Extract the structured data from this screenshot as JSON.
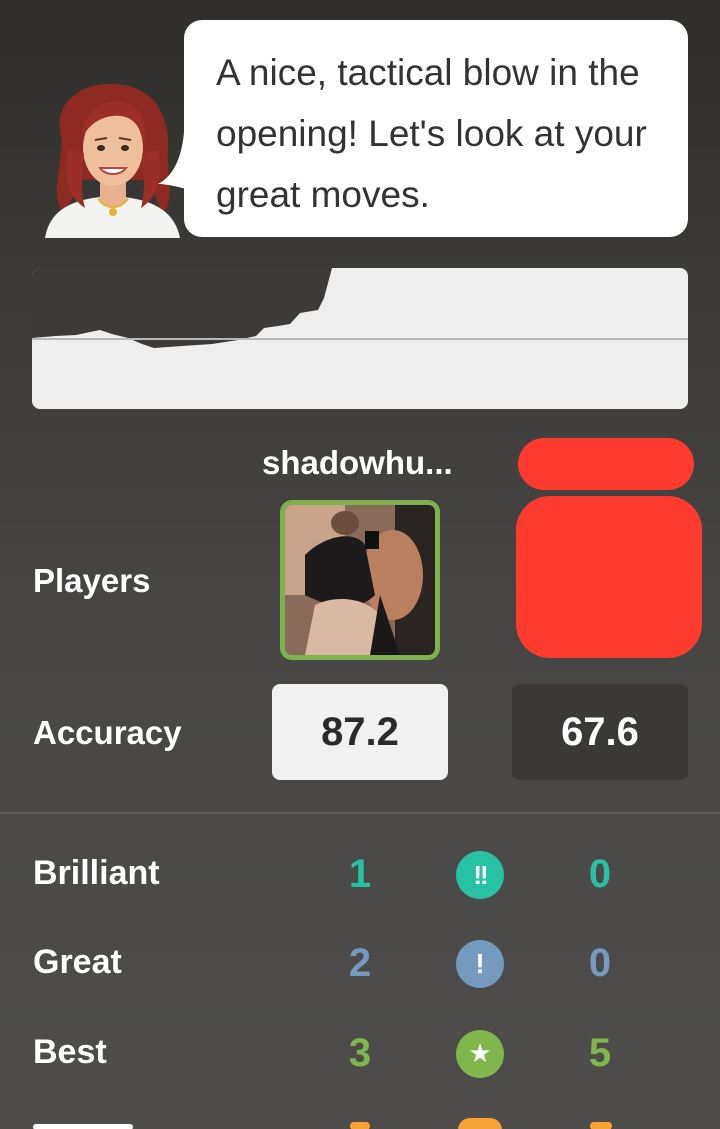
{
  "coach": {
    "message": "A nice, tactical blow in the opening! Let's look at your great moves."
  },
  "players": {
    "label": "Players",
    "left_name": "shadowhu...",
    "right_name": ""
  },
  "accuracy": {
    "label": "Accuracy",
    "left": "87.2",
    "right": "67.6"
  },
  "stats": [
    {
      "label": "Brilliant",
      "left": "1",
      "icon_text": "!!",
      "right": "0",
      "color": "#26c2a3",
      "icon": "brilliant-icon"
    },
    {
      "label": "Great",
      "left": "2",
      "icon_text": "!",
      "right": "0",
      "color": "#749bbf",
      "icon": "great-icon"
    },
    {
      "label": "Best",
      "left": "3",
      "icon_text": "★",
      "right": "5",
      "color": "#81b64c",
      "icon": "star-icon"
    }
  ],
  "colors": {
    "brilliant": "#26c2a3",
    "great": "#749bbf",
    "best": "#81b64c",
    "selected_border": "#7fb24c",
    "redaction": "#ff3b30"
  }
}
